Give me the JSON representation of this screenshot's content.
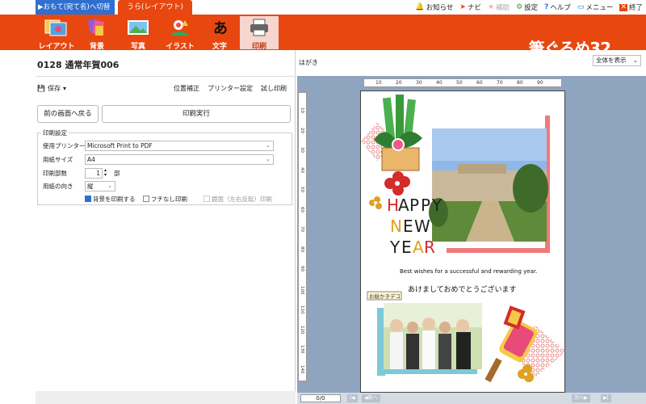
{
  "top": {
    "tab_front": "▶おもて(宛て名)へ切替",
    "tab_back": "うら(レイアウト)",
    "links": [
      {
        "icon": "🔔",
        "label": "お知らせ",
        "dim": false
      },
      {
        "icon": "➤",
        "label": "ナビ",
        "dim": false
      },
      {
        "icon": "★",
        "label": "補助",
        "dim": true
      },
      {
        "icon": "⚙",
        "label": "設定",
        "dim": false
      },
      {
        "icon": "?",
        "label": "ヘルプ",
        "dim": false
      },
      {
        "icon": "▭",
        "label": "メニュー",
        "dim": false
      },
      {
        "icon": "✕",
        "label": "終了",
        "dim": false
      }
    ]
  },
  "toolbar": {
    "buttons": [
      "レイアウト",
      "背景",
      "写真",
      "イラスト",
      "文字",
      "印刷"
    ],
    "logo": "筆ぐるめ32"
  },
  "left": {
    "doc_title": "0128 通常年賀006",
    "save_label": "保存",
    "links": [
      "位置補正",
      "プリンター設定",
      "試し印刷"
    ],
    "back_button": "前の画面へ戻る",
    "print_button": "印刷実行",
    "group_label": "印刷設定",
    "printer_label": "使用プリンター",
    "printer_value": "Microsoft Print to PDF",
    "paper_label": "用紙サイズ",
    "paper_value": "A4",
    "copies_label": "印刷部数",
    "copies_value": "1",
    "copies_unit": "部",
    "orient_label": "用紙の向き",
    "orient_value": "縦",
    "cb1": "背景を印刷する",
    "cb2": "フチなし印刷",
    "cb3": "鏡面（左右反転）印刷"
  },
  "right": {
    "title": "はがき",
    "zoom": "全体を表示",
    "h_ticks": [
      "10",
      "20",
      "30",
      "40",
      "50",
      "60",
      "70",
      "80",
      "90"
    ],
    "v_ticks": [
      "10",
      "20",
      "30",
      "40",
      "50",
      "60",
      "70",
      "80",
      "90",
      "100",
      "110",
      "120",
      "130",
      "140"
    ],
    "page_count": "0/0",
    "nav_prev": "前へ",
    "nav_next": "次へ"
  },
  "card": {
    "line1": [
      "H",
      "A",
      "P",
      "P",
      "Y"
    ],
    "line2": [
      "N",
      "E",
      "W"
    ],
    "line3": [
      "Y",
      "E",
      "A",
      "R"
    ],
    "english": "Best wishes for a successful and rewarding year.",
    "japanese": "あけましておめでとうございます",
    "tag": "お絵かきデコ"
  }
}
